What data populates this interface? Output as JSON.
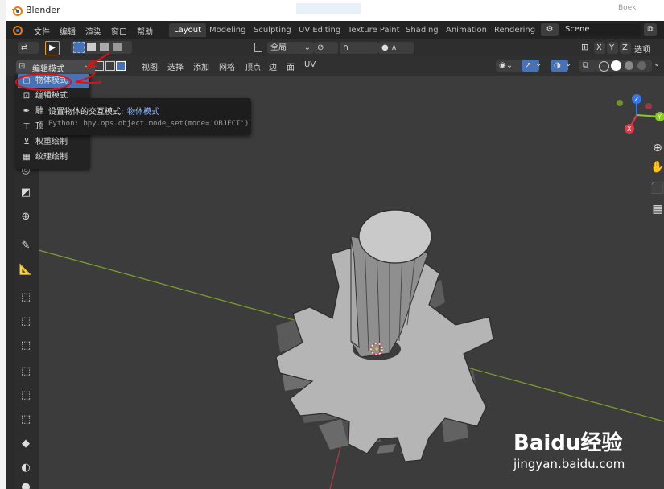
{
  "titlebar": {
    "title": "Blender",
    "right_text": "Boeki"
  },
  "menubar": {
    "items": [
      "文件",
      "编辑",
      "渲染",
      "窗口",
      "帮助"
    ],
    "workspaces": [
      "Layout",
      "Modeling",
      "Sculpting",
      "UV Editing",
      "Texture Paint",
      "Shading",
      "Animation",
      "Rendering"
    ],
    "active_workspace": "Layout",
    "scene_label": "Scene",
    "scene_right": "选项"
  },
  "toolbar": {
    "orientation": "全局",
    "axes": [
      "X",
      "Y",
      "Z"
    ]
  },
  "viewport_header": {
    "mode": "编辑模式",
    "menus": [
      "视图",
      "选择",
      "添加",
      "网格",
      "顶点",
      "边",
      "面",
      "UV"
    ]
  },
  "mode_menu": {
    "items": [
      {
        "label": "物体模式",
        "icon": "object-mode-icon",
        "selected": true
      },
      {
        "label": "编辑模式",
        "icon": "edit-mode-icon",
        "selected": false
      },
      {
        "label": "雕刻模式",
        "icon": "sculpt-mode-icon",
        "selected": false
      },
      {
        "label": "顶点绘制",
        "icon": "vertex-paint-icon",
        "selected": false
      },
      {
        "label": "权重绘制",
        "icon": "weight-paint-icon",
        "selected": false
      },
      {
        "label": "纹理绘制",
        "icon": "texture-paint-icon",
        "selected": false
      }
    ]
  },
  "tooltip": {
    "title_prefix": "设置物体的交互模式: ",
    "title_value": "物体模式",
    "python": "Python: bpy.ops.object.mode_set(mode='OBJECT')"
  },
  "gizmo": {
    "x": "X",
    "y": "Y",
    "z": "Z"
  },
  "watermark": {
    "brand": "Baidu经验",
    "url": "jingyan.baidu.com"
  },
  "colors": {
    "x_axis": "#ee3344",
    "y_axis": "#88cc22",
    "z_axis": "#3377ee",
    "selected": "#4772b3",
    "annotation": "#e01010"
  }
}
